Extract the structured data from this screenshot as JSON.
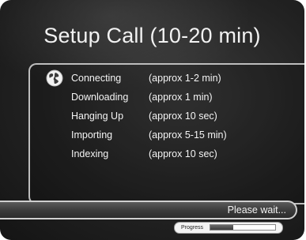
{
  "dialog": {
    "title": "Setup Call (10-20 min)",
    "steps": [
      {
        "name": "Connecting",
        "time": "(approx 1-2 min)",
        "active": true,
        "icon": "globe-icon"
      },
      {
        "name": "Downloading",
        "time": "(approx 1 min)",
        "active": false
      },
      {
        "name": "Hanging Up",
        "time": "(approx 10 sec)",
        "active": false
      },
      {
        "name": "Importing",
        "time": "(approx 5-15 min)",
        "active": false
      },
      {
        "name": "Indexing",
        "time": "(approx 10 sec)",
        "active": false
      }
    ],
    "status_text": "Please wait...",
    "progress": {
      "label": "Progress",
      "value": 0.35
    }
  },
  "colors": {
    "background": "#222222",
    "text": "#f2f2f2",
    "panel_border": "#bdbdbd"
  }
}
